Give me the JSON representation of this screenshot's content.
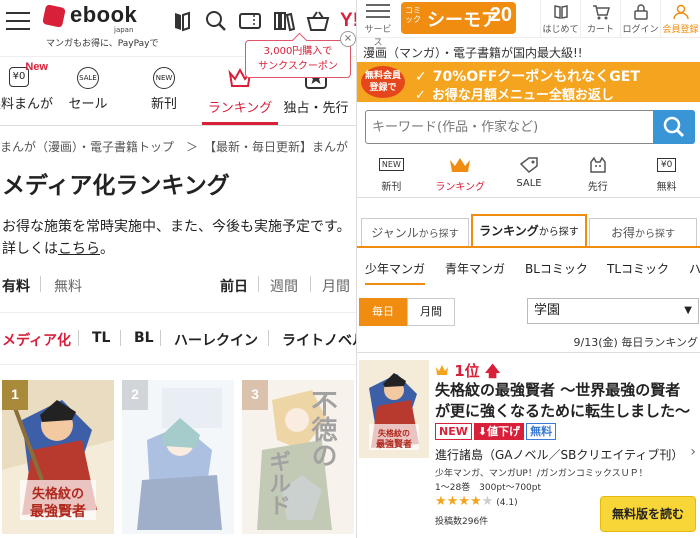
{
  "ebook": {
    "logo_text": "ebook",
    "logo_japan": "japan",
    "logo_sub": "マンガもお得に、PayPayで",
    "coupon_line1": "3,000円購入で",
    "coupon_line2": "サンクスクーポン",
    "coupon_close": "×",
    "nav": [
      {
        "icon": "¥0",
        "label": "無料まんが",
        "badge": "New"
      },
      {
        "icon": "SALE",
        "label": "セール"
      },
      {
        "icon": "NEW",
        "label": "新刊"
      },
      {
        "icon": "crown",
        "label": "ランキング"
      },
      {
        "icon": "star",
        "label": "独占・先行"
      }
    ],
    "breadcrumb": "まんが（漫画）・電子書籍トップ　＞　【最新・毎日更新】まんが",
    "page_title": "メディア化ランキング",
    "notice_text": "お得な施策を常時実施中、また、今後も実施予定です。詳しくは",
    "notice_link": "こちら",
    "notice_end": "。",
    "filter_paid": "有料",
    "filter_free": "無料",
    "period_day": "前日",
    "period_week": "週間",
    "period_month": "月間",
    "genres": [
      "メディア化",
      "TL",
      "BL",
      "ハーレクイン",
      "ライトノベル"
    ],
    "ranks": [
      "1",
      "2",
      "3"
    ],
    "cover3_text": "不徳の",
    "cover3_sub": "ギルド",
    "accent": "#d8203a"
  },
  "cmoa": {
    "menu_label": "サービス",
    "logo_small": "コミック",
    "logo_main": "シーモア",
    "logo_num": "20",
    "header_icons": [
      {
        "icon": "book-icon",
        "label": "はじめて"
      },
      {
        "icon": "cart-icon",
        "label": "カート"
      },
      {
        "icon": "lock-icon",
        "label": "ログイン"
      },
      {
        "icon": "user-icon",
        "label": "会員登録"
      }
    ],
    "headline": "漫画（マンガ）・電子書籍が国内最大級!!",
    "banner_badge": "無料会員登録で",
    "banner_line1": "70%OFFクーポンもれなくGET",
    "banner_line2": "お得な月額メニュー全額お返し",
    "search_placeholder": "キーワード(作品・作家など)",
    "nav": [
      {
        "icon": "NEW",
        "label": "新刊"
      },
      {
        "icon": "crown",
        "label": "ランキング"
      },
      {
        "icon": "tag",
        "label": "SALE"
      },
      {
        "icon": "cat",
        "label": "先行"
      },
      {
        "icon": "¥0",
        "label": "無料"
      }
    ],
    "tab_genre": "ジャンル",
    "tab_genre_suffix": "から探す",
    "tab_ranking": "ランキング",
    "tab_ranking_suffix": "から探す",
    "tab_deals": "お得",
    "tab_deals_suffix": "から探す",
    "genre_tabs": [
      "少年マンガ",
      "青年マンガ",
      "BLコミック",
      "TLコミック",
      "ハ"
    ],
    "period_daily": "毎日",
    "period_monthly": "月間",
    "select_value": "学園",
    "select_arrow": "▼",
    "ranking_date": "9/13(金) 毎日ランキング",
    "rank_label": "1位",
    "book_title": "失格紋の最強賢者 〜世界最強の賢者が更に強くなるために転生しました〜",
    "tag_new": "NEW",
    "tag_down": "値下げ",
    "tag_free": "無料",
    "author": "進行諸島（GAノベル／SBクリエイティブ刊）",
    "genre_line": "少年マンガ、マンガUP！/ガンガンコミックスＵＰ！",
    "volumes": "1〜28巻　300pt〜700pt",
    "rating": 4.1,
    "rating_text": "(4.1)",
    "reviews": "投稿数296件",
    "read_button": "無料版を読む",
    "cover_title": "失格紋の最強賢者",
    "accent": "#f08c0f"
  }
}
